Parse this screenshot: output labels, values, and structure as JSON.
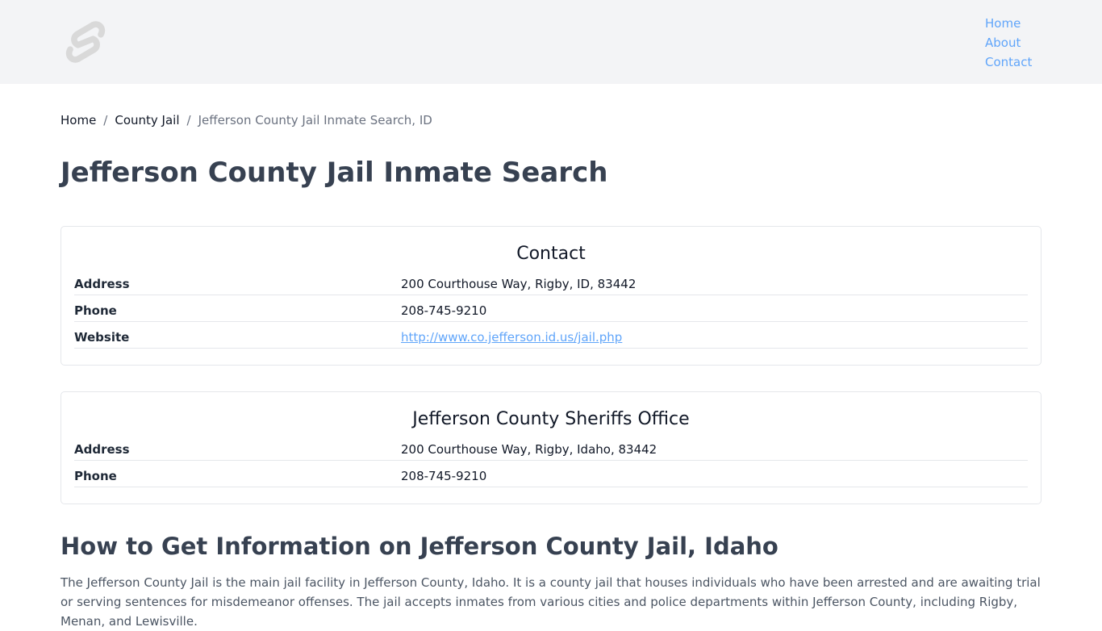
{
  "header": {
    "nav": [
      {
        "label": "Home"
      },
      {
        "label": "About"
      },
      {
        "label": "Contact"
      }
    ],
    "logo_icon": "svelte-logo-icon",
    "background": "#f3f4f6",
    "link_color": "#60a5fa"
  },
  "breadcrumb": {
    "items": [
      {
        "label": "Home"
      },
      {
        "label": "County Jail"
      }
    ],
    "separator": "/",
    "current": "Jefferson County Jail Inmate Search, ID"
  },
  "page": {
    "title": "Jefferson County Jail Inmate Search"
  },
  "contact_card": {
    "title": "Contact",
    "rows": [
      {
        "label": "Address",
        "value": "200 Courthouse Way, Rigby, ID, 83442"
      },
      {
        "label": "Phone",
        "value": "208-745-9210"
      },
      {
        "label": "Website",
        "value": "http://www.co.jefferson.id.us/jail.php"
      }
    ]
  },
  "sheriff_card": {
    "title": "Jefferson County Sheriffs Office",
    "rows": [
      {
        "label": "Address",
        "value": "200 Courthouse Way, Rigby, Idaho, 83442"
      },
      {
        "label": "Phone",
        "value": "208-745-9210"
      }
    ]
  },
  "info_section": {
    "heading": "How to Get Information on Jefferson County Jail, Idaho",
    "paragraph": "The Jefferson County Jail is the main jail facility in Jefferson County, Idaho. It is a county jail that houses individuals who have been arrested and are awaiting trial or serving sentences for misdemeanor offenses. The jail accepts inmates from various cities and police departments within Jefferson County, including Rigby, Menan, and Lewisville."
  }
}
